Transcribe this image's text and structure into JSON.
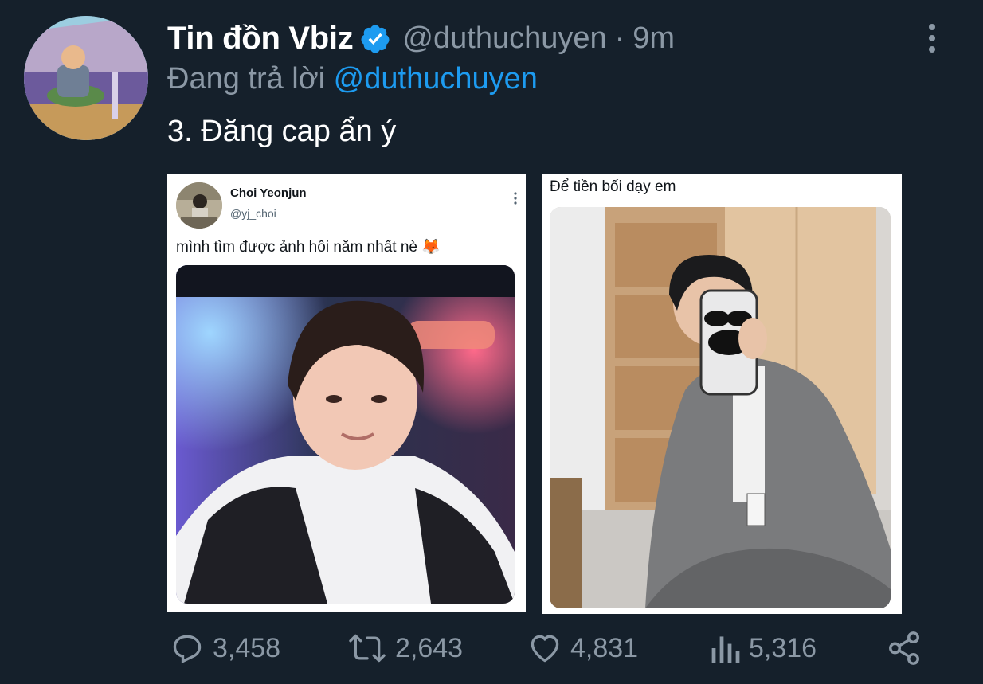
{
  "tweet": {
    "author_name": "Tin đồn Vbiz",
    "handle": "@duthuchuyen",
    "separator": "·",
    "time": "9m",
    "reply_prefix": "Đang trả lời",
    "reply_mention": "@duthuchuyen",
    "text": "3. Đăng cap ẩn ý"
  },
  "media": {
    "left": {
      "name": "Choi Yeonjun",
      "handle": "@yj_choi",
      "text": "mình tìm được ảnh hồi năm nhất nè 🦊"
    },
    "right": {
      "text": "Để tiền bối dạy em"
    }
  },
  "actions": {
    "reply_count": "3,458",
    "retweet_count": "2,643",
    "like_count": "4,831",
    "views_count": "5,316"
  },
  "colors": {
    "background": "#15202b",
    "muted": "#8b98a5",
    "accent": "#1d9bf0"
  },
  "icons": [
    "verified-badge-icon",
    "more-options-icon",
    "reply-icon",
    "retweet-icon",
    "like-icon",
    "views-icon",
    "share-icon"
  ]
}
